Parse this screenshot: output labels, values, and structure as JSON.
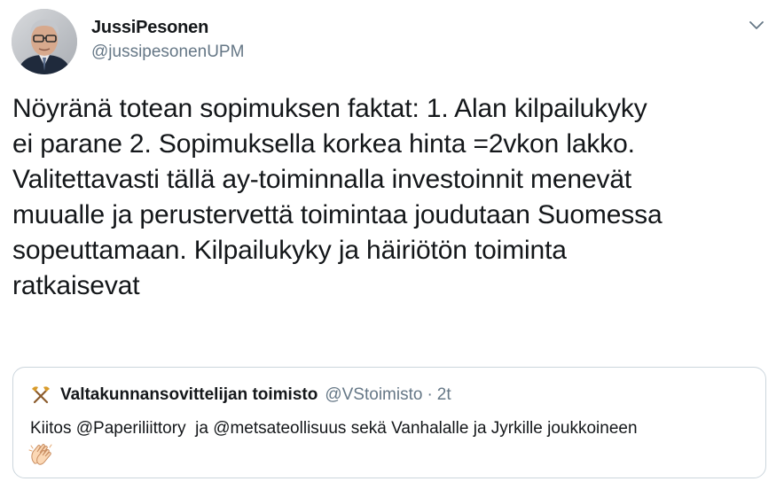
{
  "author": {
    "display_name": "JussiPesonen",
    "handle": "@jussipesonenUPM"
  },
  "tweet": {
    "text": "Nöyränä totean sopimuksen faktat: 1. Alan kilpailukyky\nei parane 2. Sopimuksella korkea hinta =2vkon lakko.\nValitettavasti tällä ay-toiminnalla investoinnit menevät\nmuualle ja perustervettä toimintaa joudutaan Suomessa\nsopeuttamaan. Kilpailukyky ja häiriötön toiminta\nratkaisevat"
  },
  "quoted_tweet": {
    "display_name": "Valtakunnansovittelijan toimisto",
    "handle": "@VStoimisto",
    "separator": "·",
    "time": "2t",
    "text": "Kiitos @Paperiliittory  ja @metsateollisuus sekä Vanhalalle ja Jyrkille joukkoineen",
    "icon": "crossed-pickaxe-icon",
    "emoji": "clapping-hands-emoji"
  },
  "colors": {
    "primary_text": "#14171a",
    "secondary_text": "#657786",
    "border": "#ccd6dd"
  },
  "icons": {
    "caret": "chevron-down-icon"
  }
}
